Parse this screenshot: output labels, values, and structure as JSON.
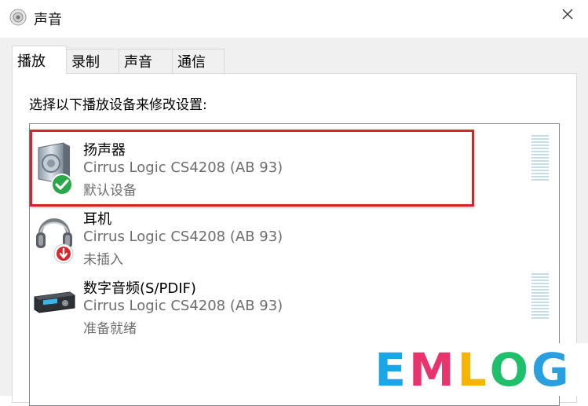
{
  "window": {
    "title": "声音"
  },
  "tabs": [
    {
      "label": "播放",
      "active": true
    },
    {
      "label": "录制",
      "active": false
    },
    {
      "label": "声音",
      "active": false
    },
    {
      "label": "通信",
      "active": false
    }
  ],
  "playback": {
    "instruction": "选择以下播放设备来修改设置:",
    "devices": [
      {
        "name": "扬声器",
        "description": "Cirrus Logic CS4208 (AB 93)",
        "status": "默认设备",
        "icon": "speaker-icon",
        "badge": "check-badge-icon",
        "selected": true
      },
      {
        "name": "耳机",
        "description": "Cirrus Logic CS4208 (AB 93)",
        "status": "未插入",
        "icon": "headphones-icon",
        "badge": "unplugged-badge-icon",
        "selected": false
      },
      {
        "name": "数字音频(S/PDIF)",
        "description": "Cirrus Logic CS4208 (AB 93)",
        "status": "准备就绪",
        "icon": "digital-audio-icon",
        "badge": "",
        "selected": false
      }
    ]
  },
  "watermark": {
    "text": "EMLOG",
    "letters": [
      "E",
      "M",
      "L",
      "O",
      "G"
    ],
    "colors": [
      "#1aa7e8",
      "#e8336d",
      "#f5b400",
      "#1fc06b",
      "#2a9fe0"
    ]
  },
  "colors": {
    "highlight": "#d0262c",
    "secondary_text": "#6d6d6d",
    "list_border": "#828790"
  }
}
